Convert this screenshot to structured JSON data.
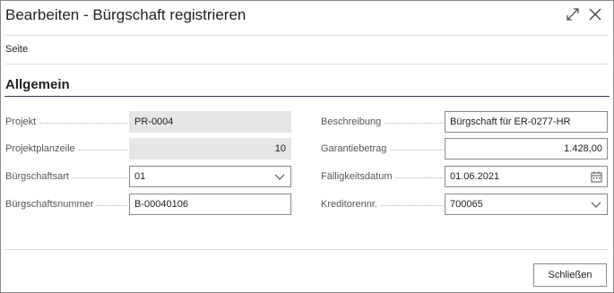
{
  "window": {
    "title": "Bearbeiten - Bürgschaft registrieren",
    "expand_icon": "expand-icon",
    "close_icon": "close-icon"
  },
  "action_bar": {
    "page_label": "Seite"
  },
  "section": {
    "title": "Allgemein"
  },
  "fields_left": [
    {
      "label": "Projekt",
      "value": "PR-0004",
      "editable": false,
      "align": "left"
    },
    {
      "label": "Projektplanzeile",
      "value": "10",
      "editable": false,
      "align": "right"
    },
    {
      "label": "Bürgschaftsart",
      "value": "01",
      "editable": true,
      "control": "dropdown"
    },
    {
      "label": "Bürgschaftsnummer",
      "value": "B-00040106",
      "editable": true
    }
  ],
  "fields_right": [
    {
      "label": "Beschreibung",
      "value": "Bürgschaft für ER-0277-HR",
      "editable": true
    },
    {
      "label": "Garantiebetrag",
      "value": "1.428,00",
      "editable": true,
      "align": "right"
    },
    {
      "label": "Fälligkeitsdatum",
      "value": "01.06.2021",
      "editable": true,
      "control": "date-picker",
      "icon": "calendar-icon"
    },
    {
      "label": "Kreditorennr.",
      "value": "700065",
      "editable": true,
      "control": "dropdown"
    }
  ],
  "footer": {
    "close_label": "Schließen"
  },
  "colors": {
    "readonly_fill": "#e6e6e6",
    "border": "#8a8a8a",
    "section_rule": "#2f3e4e"
  }
}
